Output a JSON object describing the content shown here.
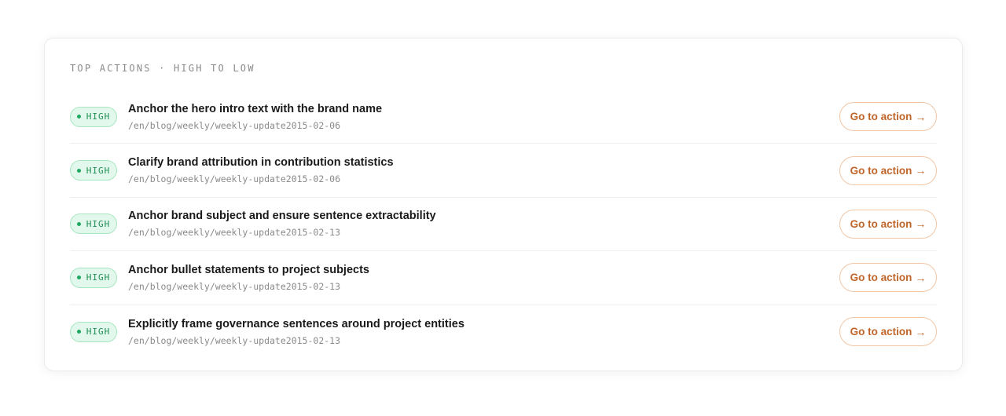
{
  "panel": {
    "title": "TOP ACTIONS · HIGH TO LOW"
  },
  "actions": [
    {
      "priority": "HIGH",
      "title": "Anchor the hero intro text with the brand name",
      "path": "/en/blog/weekly/weekly-update2015-02-06",
      "button_label": "Go to action",
      "button_arrow": "→"
    },
    {
      "priority": "HIGH",
      "title": "Clarify brand attribution in contribution statistics",
      "path": "/en/blog/weekly/weekly-update2015-02-06",
      "button_label": "Go to action",
      "button_arrow": "→"
    },
    {
      "priority": "HIGH",
      "title": "Anchor brand subject and ensure sentence extractability",
      "path": "/en/blog/weekly/weekly-update2015-02-13",
      "button_label": "Go to action",
      "button_arrow": "→"
    },
    {
      "priority": "HIGH",
      "title": "Anchor bullet statements to project subjects",
      "path": "/en/blog/weekly/weekly-update2015-02-13",
      "button_label": "Go to action",
      "button_arrow": "→"
    },
    {
      "priority": "HIGH",
      "title": "Explicitly frame governance sentences around project entities",
      "path": "/en/blog/weekly/weekly-update2015-02-13",
      "button_label": "Go to action",
      "button_arrow": "→"
    }
  ],
  "colors": {
    "badge_bg": "#e3f8ec",
    "badge_text": "#1f8f55",
    "button_text": "#c0652a",
    "button_border": "#f0c6a6"
  }
}
